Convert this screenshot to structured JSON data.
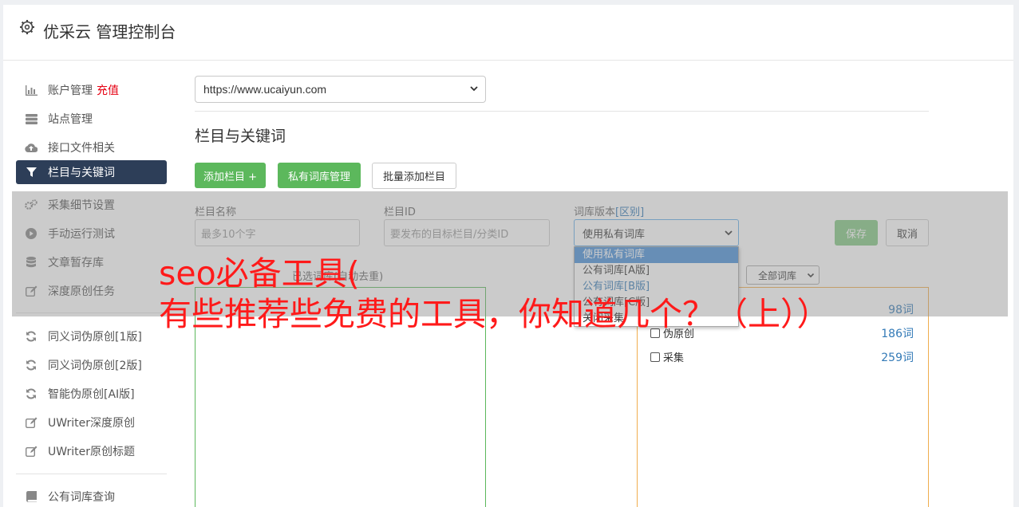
{
  "app": {
    "title": "优采云 管理控制台"
  },
  "sidebar": {
    "items": [
      {
        "label": "账户管理",
        "icon": "bar-chart-icon",
        "badge": "充值"
      },
      {
        "label": "站点管理",
        "icon": "server-icon"
      },
      {
        "label": "接口文件相关",
        "icon": "cloud-upload-icon"
      },
      {
        "label": "栏目与关键词",
        "icon": "filter-icon",
        "active": true
      },
      {
        "label": "采集细节设置",
        "icon": "gears-icon"
      },
      {
        "label": "手动运行测试",
        "icon": "play-circle-icon"
      },
      {
        "label": "文章暂存库",
        "icon": "database-icon"
      },
      {
        "label": "深度原创任务",
        "icon": "edit-icon"
      },
      {
        "label": "同义词伪原创[1版]",
        "icon": "refresh-icon"
      },
      {
        "label": "同义词伪原创[2版]",
        "icon": "refresh-icon"
      },
      {
        "label": "智能伪原创[AI版]",
        "icon": "refresh-icon"
      },
      {
        "label": "UWriter深度原创",
        "icon": "edit-icon"
      },
      {
        "label": "UWriter原创标题",
        "icon": "edit-icon"
      },
      {
        "label": "公有词库查询",
        "icon": "book-icon"
      }
    ]
  },
  "main": {
    "site_select": {
      "value": "https://www.ucaiyun.com"
    },
    "section_title": "栏目与关键词",
    "buttons": {
      "add_column": "添加栏目 +",
      "private_lib": "私有词库管理",
      "batch_add": "批量添加栏目"
    },
    "form": {
      "name_label": "栏目名称",
      "name_placeholder": "最多10个字",
      "id_label": "栏目ID",
      "id_placeholder": "要发布的目标栏目/分类ID",
      "lib_label": "词库版本",
      "lib_label_link": "[区别]",
      "lib_value": "使用私有词库",
      "save": "保存",
      "cancel": "取消"
    },
    "lib_options": [
      "使用私有词库",
      "公有词库[A版]",
      "公有词库[B版]",
      "公有词库[C版]",
      "关闭采集"
    ],
    "selected_words_label": "已选词库(自动去重)",
    "filter_all": "全部词库",
    "libraries": [
      {
        "name": "",
        "count": "98词"
      },
      {
        "name": "伪原创",
        "count": "186词"
      },
      {
        "name": "采集",
        "count": "259词"
      }
    ]
  },
  "overlay": {
    "line1": "seo必备工具(",
    "line2": "有些推荐些免费的工具，你知道几个？（上））"
  },
  "colors": {
    "accent_green": "#5cb85c",
    "active_nav": "#2d3e58",
    "link_blue": "#337ab7",
    "overlay_text": "#ff1a1a",
    "recharge_red": "#e60012"
  }
}
